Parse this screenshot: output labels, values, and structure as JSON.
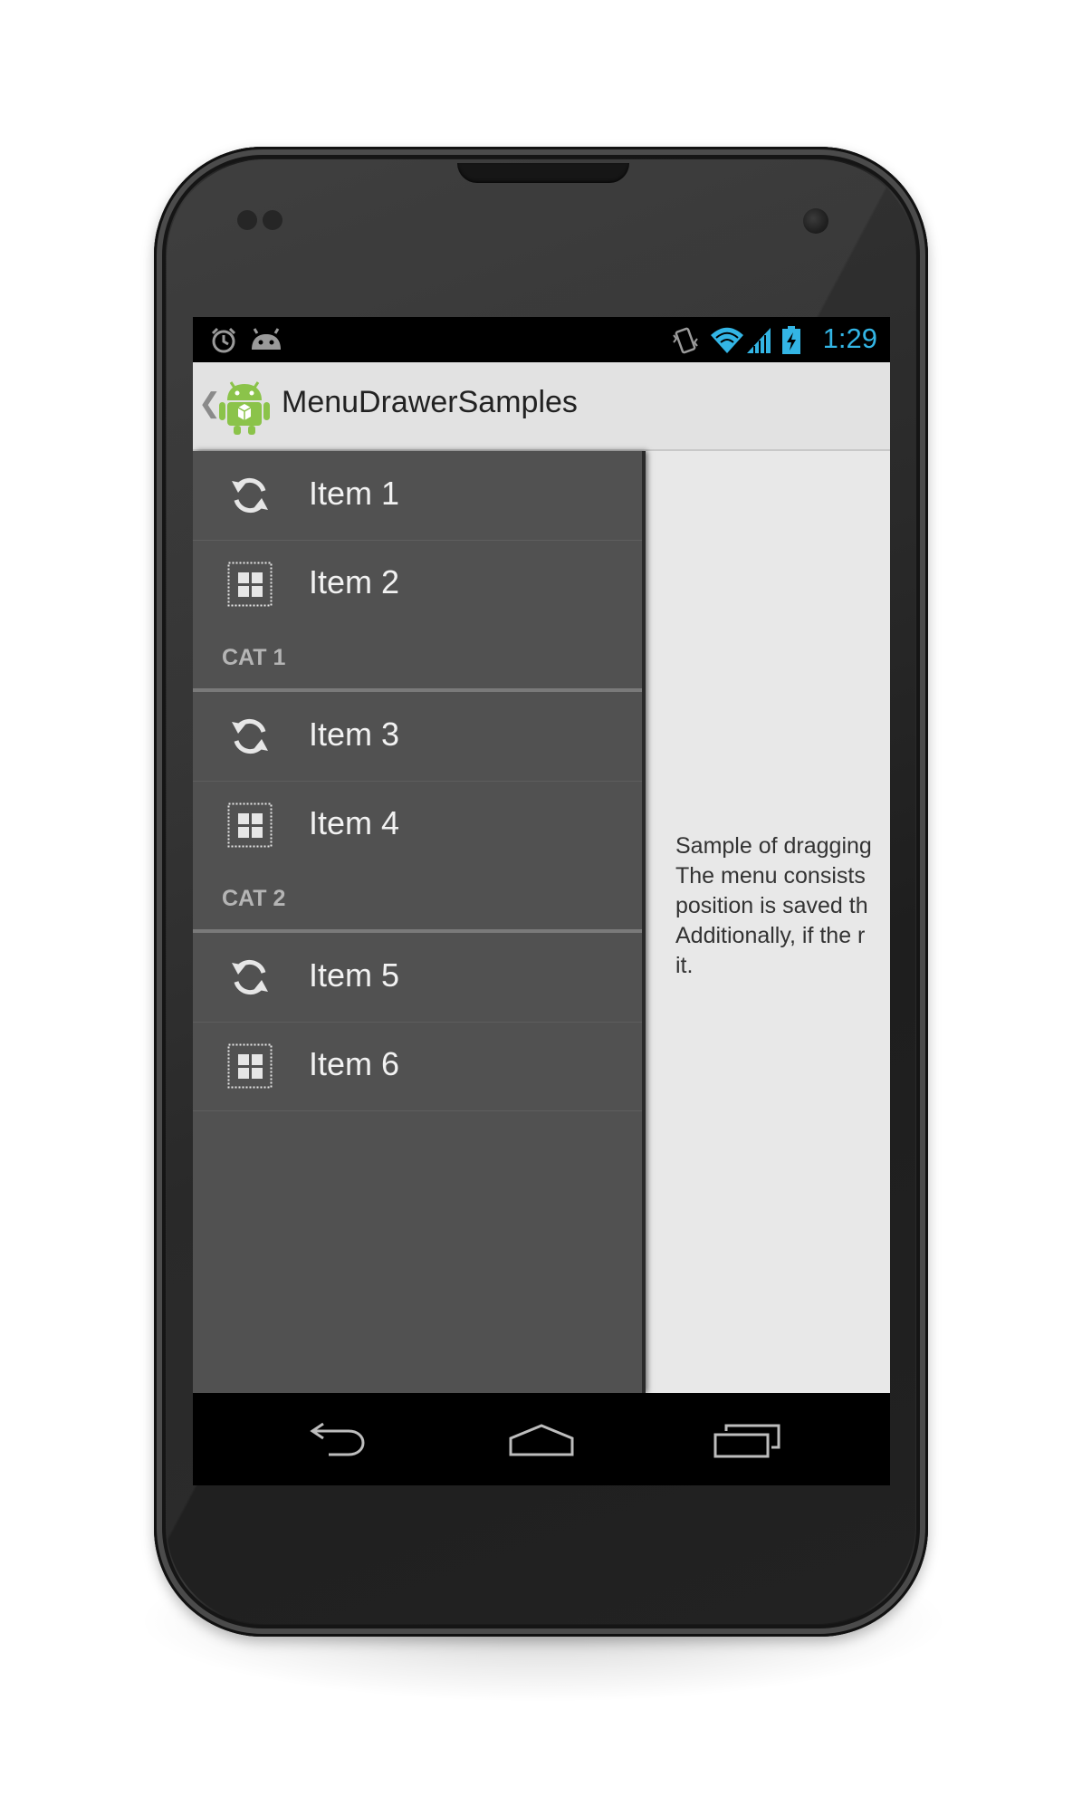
{
  "status_bar": {
    "icons": [
      "alarm-icon",
      "android-debug-icon",
      "vibrate-icon",
      "wifi-icon",
      "signal-icon",
      "battery-charging-icon"
    ],
    "time": "1:29",
    "accent": "#33b5e5"
  },
  "action_bar": {
    "up_icon": "chevron-left-icon",
    "app_icon": "android-app-icon",
    "title": "MenuDrawerSamples"
  },
  "menu": {
    "items": [
      {
        "label": "Item 1",
        "icon": "refresh-icon"
      },
      {
        "label": "Item 2",
        "icon": "grid-icon"
      },
      {
        "category": "CAT 1"
      },
      {
        "label": "Item 3",
        "icon": "refresh-icon"
      },
      {
        "label": "Item 4",
        "icon": "grid-icon"
      },
      {
        "category": "CAT 2"
      },
      {
        "label": "Item 5",
        "icon": "refresh-icon"
      },
      {
        "label": "Item 6",
        "icon": "grid-icon"
      }
    ]
  },
  "content": {
    "lines": [
      "Sample of dragging",
      "The menu consists",
      "position is saved th",
      "Additionally, if the r",
      "it."
    ]
  },
  "nav_bar": {
    "buttons": [
      "back-icon",
      "home-icon",
      "recent-apps-icon"
    ]
  }
}
